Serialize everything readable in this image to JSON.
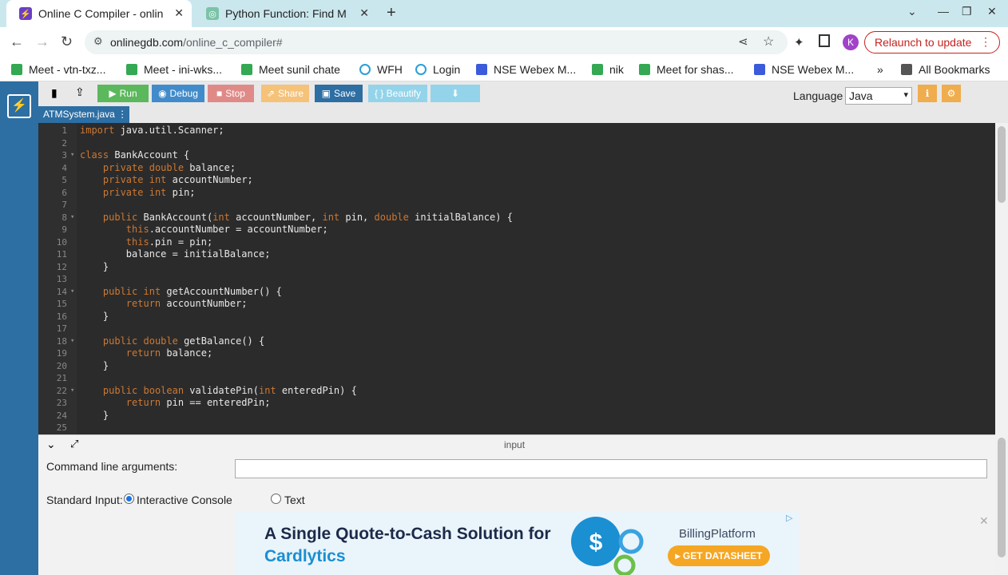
{
  "browser": {
    "tabs": [
      {
        "title": "Online C Compiler - onlin",
        "active": true
      },
      {
        "title": "Python Function: Find M",
        "active": false
      }
    ],
    "new_tab": "+",
    "close_glyph": "✕",
    "address": {
      "host": "onlinegdb.com",
      "path": "/online_c_compiler#"
    },
    "avatar_letter": "K",
    "relaunch_label": "Relaunch to update",
    "bookmarks": [
      "Meet - vtn-txz...",
      "Meet - ini-wks...",
      "Meet sunil chate",
      "WFH",
      "Login",
      "NSE Webex M...",
      "nik",
      "Meet for shas...",
      "NSE Webex M..."
    ],
    "bookmarks_overflow": "»",
    "all_bookmarks": "All Bookmarks"
  },
  "ide": {
    "buttons": {
      "run": "Run",
      "debug": "Debug",
      "stop": "Stop",
      "share": "Share",
      "save": "Save",
      "beautify": "{ } Beautify"
    },
    "language_label": "Language",
    "language_value": "Java",
    "file_tab": "ATMSystem.java",
    "code_lines": [
      {
        "n": "1",
        "code": "import java.util.Scanner;"
      },
      {
        "n": "2",
        "code": ""
      },
      {
        "n": "3",
        "code": "class BankAccount {"
      },
      {
        "n": "4",
        "code": "    private double balance;"
      },
      {
        "n": "5",
        "code": "    private int accountNumber;"
      },
      {
        "n": "6",
        "code": "    private int pin;"
      },
      {
        "n": "7",
        "code": ""
      },
      {
        "n": "8",
        "code": "    public BankAccount(int accountNumber, int pin, double initialBalance) {"
      },
      {
        "n": "9",
        "code": "        this.accountNumber = accountNumber;"
      },
      {
        "n": "10",
        "code": "        this.pin = pin;"
      },
      {
        "n": "11",
        "code": "        balance = initialBalance;"
      },
      {
        "n": "12",
        "code": "    }"
      },
      {
        "n": "13",
        "code": ""
      },
      {
        "n": "14",
        "code": "    public int getAccountNumber() {"
      },
      {
        "n": "15",
        "code": "        return accountNumber;"
      },
      {
        "n": "16",
        "code": "    }"
      },
      {
        "n": "17",
        "code": ""
      },
      {
        "n": "18",
        "code": "    public double getBalance() {"
      },
      {
        "n": "19",
        "code": "        return balance;"
      },
      {
        "n": "20",
        "code": "    }"
      },
      {
        "n": "21",
        "code": ""
      },
      {
        "n": "22",
        "code": "    public boolean validatePin(int enteredPin) {"
      },
      {
        "n": "23",
        "code": "        return pin == enteredPin;"
      },
      {
        "n": "24",
        "code": "    }"
      },
      {
        "n": "25",
        "code": ""
      }
    ],
    "input_panel": {
      "title": "input",
      "cmd_label": "Command line arguments:",
      "cmd_value": "",
      "std_label": "Standard Input:",
      "opt_console": "Interactive Console",
      "opt_text": "Text",
      "selected": "Interactive Console"
    },
    "ad": {
      "headline1": "A Single Quote-to-Cash Solution for",
      "headline2": "Cardlytics",
      "brand": "BillingPlatform",
      "cta": "▸ GET DATASHEET",
      "close": "✕"
    }
  },
  "colors": {
    "sidebar": "#2d6ea3",
    "run": "#5cb85c",
    "debug": "#428bca",
    "stop": "#d9534f",
    "share": "#f0ad4e",
    "save": "#2d6ea3",
    "beautify": "#5bc0de"
  }
}
